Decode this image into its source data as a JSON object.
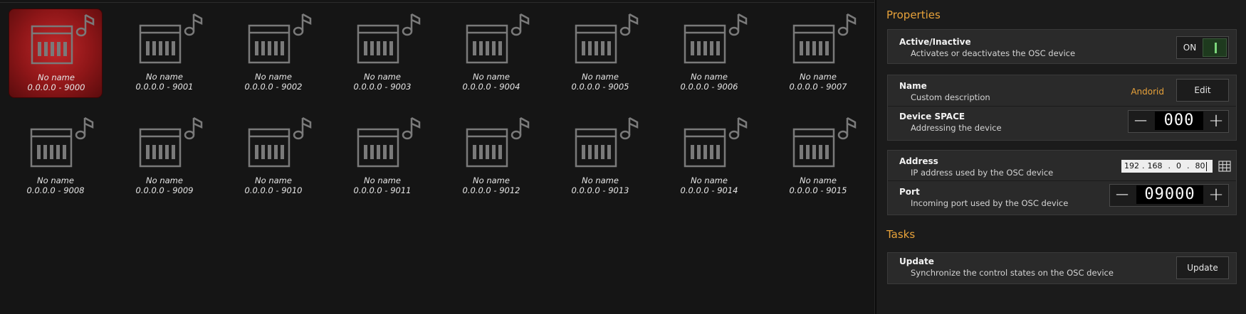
{
  "devices": [
    {
      "name": "No name",
      "address": "0.0.0.0 - 9000",
      "selected": true
    },
    {
      "name": "No name",
      "address": "0.0.0.0 - 9001"
    },
    {
      "name": "No name",
      "address": "0.0.0.0 - 9002"
    },
    {
      "name": "No name",
      "address": "0.0.0.0 - 9003"
    },
    {
      "name": "No name",
      "address": "0.0.0.0 - 9004"
    },
    {
      "name": "No name",
      "address": "0.0.0.0 - 9005"
    },
    {
      "name": "No name",
      "address": "0.0.0.0 - 9006"
    },
    {
      "name": "No name",
      "address": "0.0.0.0 - 9007"
    },
    {
      "name": "No name",
      "address": "0.0.0.0 - 9008"
    },
    {
      "name": "No name",
      "address": "0.0.0.0 - 9009"
    },
    {
      "name": "No name",
      "address": "0.0.0.0 - 9010"
    },
    {
      "name": "No name",
      "address": "0.0.0.0 - 9011"
    },
    {
      "name": "No name",
      "address": "0.0.0.0 - 9012"
    },
    {
      "name": "No name",
      "address": "0.0.0.0 - 9013"
    },
    {
      "name": "No name",
      "address": "0.0.0.0 - 9014"
    },
    {
      "name": "No name",
      "address": "0.0.0.0 - 9015"
    }
  ],
  "device_icon": "piano-keyboard-music-note-icon",
  "properties": {
    "title": "Properties",
    "active": {
      "title": "Active/Inactive",
      "description": "Activates or deactivates the OSC device",
      "toggle_label": "ON",
      "state": "on"
    },
    "name": {
      "title": "Name",
      "description": "Custom description",
      "value": "Andorid",
      "button": "Edit"
    },
    "device_space": {
      "title": "Device SPACE",
      "description": "Addressing the device",
      "value": "000",
      "minus": "−",
      "plus": "+"
    },
    "address": {
      "title": "Address",
      "description": "IP address used by the OSC device",
      "ip": [
        "192",
        "168",
        "0",
        "80"
      ],
      "sep": "."
    },
    "port": {
      "title": "Port",
      "description": "Incoming port used by the OSC device",
      "value": "09000",
      "minus": "−",
      "plus": "+"
    }
  },
  "tasks": {
    "title": "Tasks",
    "update": {
      "title": "Update",
      "description": "Synchronize the control states on the OSC device",
      "button": "Update"
    }
  },
  "colors": {
    "accent": "#e8a23a",
    "selected_tile": "#b01e20",
    "toggle_on": "#7cd67c",
    "icon_stroke": "#7a7a7a"
  }
}
